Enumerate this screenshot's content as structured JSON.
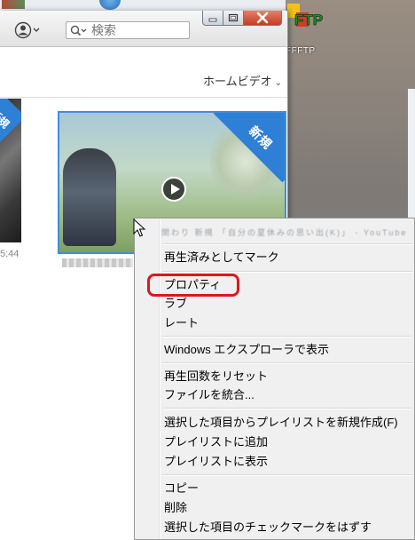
{
  "desktop": {
    "ftp_label": "FFFTP",
    "ftp_icon_text": "FTP"
  },
  "window": {
    "search_placeholder": "検索",
    "category": "ホームビデオ",
    "account_icon": "user-account-icon"
  },
  "library": {
    "left_tile_badge": "新規",
    "left_tile_time": "5:44",
    "main_tile_badge": "新規"
  },
  "context_menu": {
    "header_text": "関わり 新規 「自分の夏休みの思い出(K)」 - YouTube 「自分の",
    "items": [
      "再生済みとしてマーク",
      "プロパティ",
      "ラブ",
      "レート",
      "Windows エクスプローラで表示",
      "再生回数をリセット",
      "ファイルを統合...",
      "選択した項目からプレイリストを新規作成(F)",
      "プレイリストに追加",
      "プレイリストに表示",
      "コピー",
      "削除",
      "選択した項目のチェックマークをはずす"
    ],
    "highlighted_item": "プロパティ",
    "highlight_color": "#e0161c"
  },
  "colors": {
    "accent_blue": "#2e7fd6",
    "menu_bg": "#f0f0f0",
    "close_button": "#c33b22"
  }
}
